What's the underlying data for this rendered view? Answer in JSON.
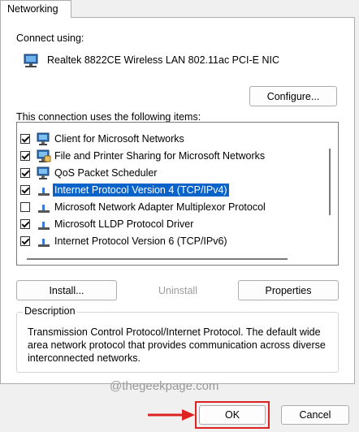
{
  "tab": {
    "label": "Networking"
  },
  "connect_using": {
    "label": "Connect using:",
    "adapter_name": "Realtek 8822CE Wireless LAN 802.11ac PCI-E NIC",
    "adapter_icon": "network-adapter-icon"
  },
  "configure_button": "Configure...",
  "items_label": "This connection uses the following items:",
  "items": [
    {
      "label": "Client for Microsoft Networks",
      "checked": true,
      "icon": "client-network-icon",
      "selected": false
    },
    {
      "label": "File and Printer Sharing for Microsoft Networks",
      "checked": true,
      "icon": "file-printer-sharing-icon",
      "selected": false
    },
    {
      "label": "QoS Packet Scheduler",
      "checked": true,
      "icon": "qos-scheduler-icon",
      "selected": false
    },
    {
      "label": "Internet Protocol Version 4 (TCP/IPv4)",
      "checked": true,
      "icon": "protocol-icon",
      "selected": true
    },
    {
      "label": "Microsoft Network Adapter Multiplexor Protocol",
      "checked": false,
      "icon": "protocol-icon",
      "selected": false
    },
    {
      "label": "Microsoft LLDP Protocol Driver",
      "checked": true,
      "icon": "protocol-icon",
      "selected": false
    },
    {
      "label": "Internet Protocol Version 6 (TCP/IPv6)",
      "checked": true,
      "icon": "protocol-icon",
      "selected": false
    }
  ],
  "buttons": {
    "install": "Install...",
    "uninstall": "Uninstall",
    "properties": "Properties",
    "ok": "OK",
    "cancel": "Cancel"
  },
  "description": {
    "title": "Description",
    "text": "Transmission Control Protocol/Internet Protocol. The default wide area network protocol that provides communication across diverse interconnected networks."
  },
  "watermark": "@thegeekpage.com",
  "colors": {
    "selection": "#0a63c9",
    "annotation": "#dd2222",
    "background": "#f0f0f0"
  }
}
